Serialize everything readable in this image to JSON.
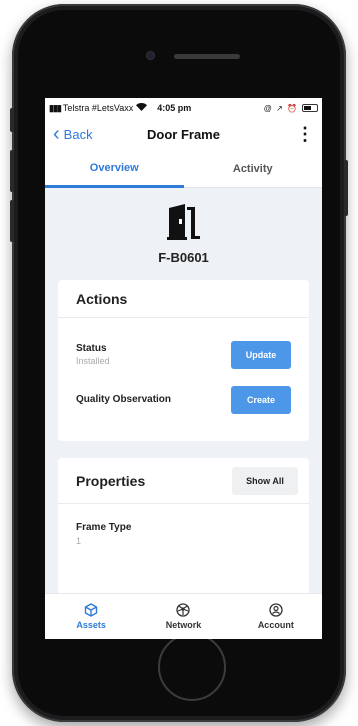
{
  "status_bar": {
    "carrier": "Telstra #LetsVaxx",
    "time": "4:05 pm",
    "system_icons": "@ ↗ ⏰"
  },
  "nav": {
    "back_label": "Back",
    "title": "Door Frame",
    "menu_glyph": "⋮"
  },
  "tabs": [
    {
      "label": "Overview",
      "active": true
    },
    {
      "label": "Activity",
      "active": false
    }
  ],
  "asset": {
    "icon": "door-icon",
    "code": "F-B0601"
  },
  "actions": {
    "title": "Actions",
    "rows": [
      {
        "label": "Status",
        "value": "Installed",
        "button": "Update"
      },
      {
        "label": "Quality Observation",
        "button": "Create"
      }
    ]
  },
  "properties": {
    "title": "Properties",
    "show_all_label": "Show All",
    "items": [
      {
        "label": "Frame Type",
        "value": "1"
      }
    ]
  },
  "bottom_nav": [
    {
      "label": "Assets",
      "icon": "cube-icon",
      "active": true
    },
    {
      "label": "Network",
      "icon": "network-icon",
      "active": false
    },
    {
      "label": "Account",
      "icon": "account-icon",
      "active": false
    }
  ],
  "colors": {
    "accent": "#2f7bd8",
    "button_blue": "#4d97e8",
    "background": "#eef2f6"
  }
}
